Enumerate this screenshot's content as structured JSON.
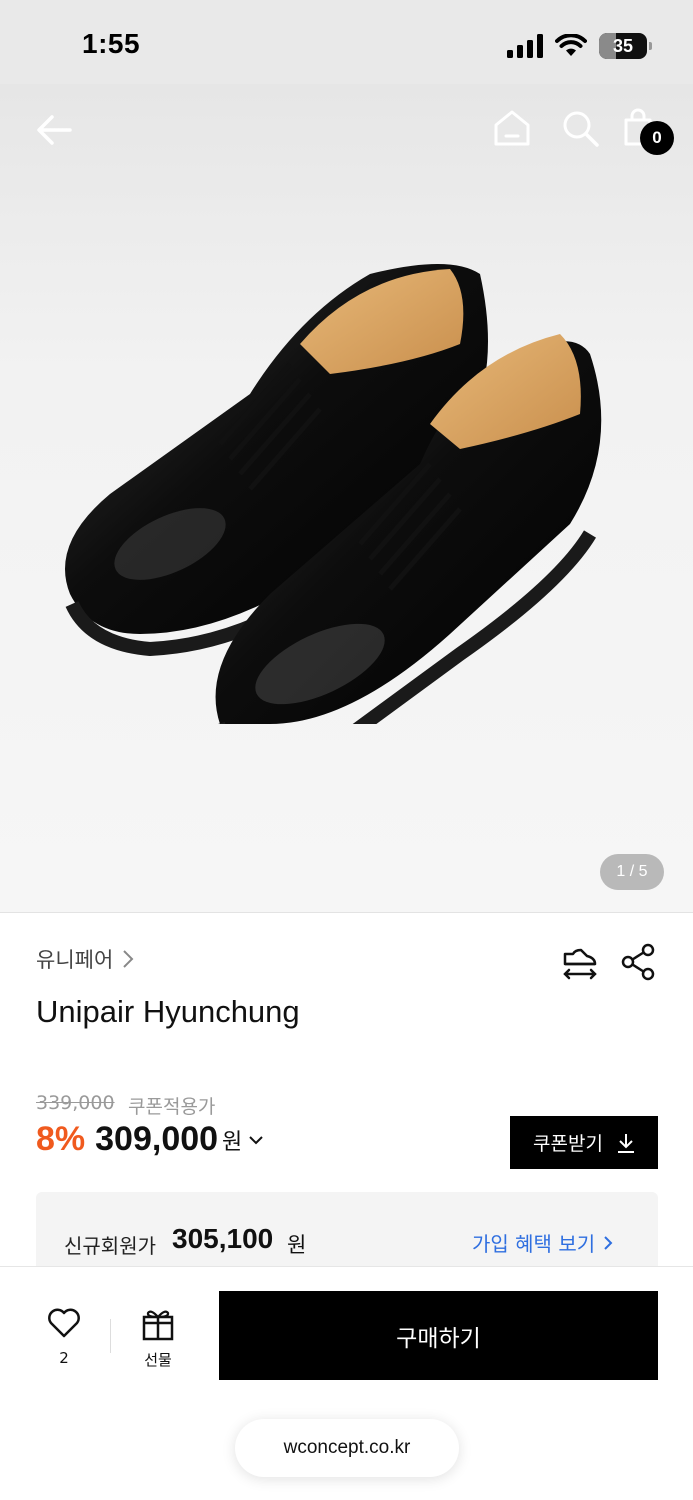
{
  "status_bar": {
    "time": "1:55",
    "battery": "35",
    "battery_level": 0.35
  },
  "hero": {
    "cart_count": "0",
    "pager": "1 / 5",
    "image": "black-derby-shoes"
  },
  "product": {
    "brand": "유니페어",
    "title": "Unipair Hyunchung",
    "original_price": "339,000",
    "coupon_label": "쿠폰적용가",
    "discount": "8%",
    "price": "309,000",
    "currency": "원",
    "coupon_button": "쿠폰받기"
  },
  "member": {
    "label": "신규회원가",
    "price": "305,100",
    "currency": "원",
    "benefit_link": "가입 혜택 보기"
  },
  "bottom_bar": {
    "wish_count": "2",
    "gift_label": "선물",
    "buy_label": "구매하기"
  },
  "browser": {
    "url": "wconcept.co.kr"
  },
  "colors": {
    "discount": "#f05a1e",
    "link": "#2f6fe0",
    "buy_button": "#000000"
  }
}
